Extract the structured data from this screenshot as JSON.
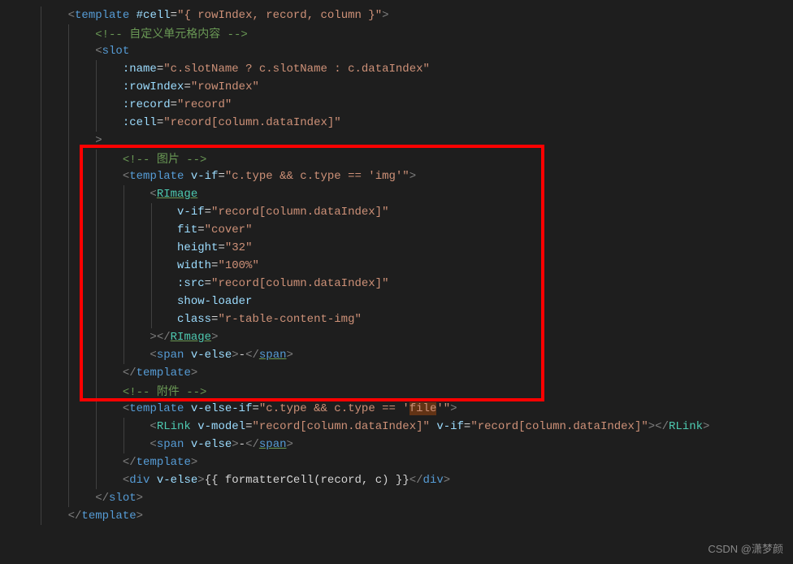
{
  "lines": [
    {
      "indent": 1,
      "segments": [
        {
          "t": "<",
          "c": "c-punct"
        },
        {
          "t": "template",
          "c": "c-tag"
        },
        {
          "t": " ",
          "c": ""
        },
        {
          "t": "#cell",
          "c": "c-attr"
        },
        {
          "t": "=",
          "c": "c-eq"
        },
        {
          "t": "\"{ rowIndex, record, column }\"",
          "c": "c-str"
        },
        {
          "t": ">",
          "c": "c-punct"
        }
      ]
    },
    {
      "indent": 2,
      "segments": [
        {
          "t": "<!-- 自定义单元格内容 -->",
          "c": "c-comment"
        }
      ]
    },
    {
      "indent": 2,
      "segments": [
        {
          "t": "<",
          "c": "c-punct"
        },
        {
          "t": "slot",
          "c": "c-tag"
        }
      ]
    },
    {
      "indent": 3,
      "segments": [
        {
          "t": ":name",
          "c": "c-attr"
        },
        {
          "t": "=",
          "c": "c-eq"
        },
        {
          "t": "\"c.slotName ? c.slotName : c.dataIndex\"",
          "c": "c-str"
        }
      ]
    },
    {
      "indent": 3,
      "segments": [
        {
          "t": ":rowIndex",
          "c": "c-attr"
        },
        {
          "t": "=",
          "c": "c-eq"
        },
        {
          "t": "\"rowIndex\"",
          "c": "c-str"
        }
      ]
    },
    {
      "indent": 3,
      "segments": [
        {
          "t": ":record",
          "c": "c-attr"
        },
        {
          "t": "=",
          "c": "c-eq"
        },
        {
          "t": "\"record\"",
          "c": "c-str"
        }
      ]
    },
    {
      "indent": 3,
      "segments": [
        {
          "t": ":cell",
          "c": "c-attr"
        },
        {
          "t": "=",
          "c": "c-eq"
        },
        {
          "t": "\"record[column.dataIndex]\"",
          "c": "c-str"
        }
      ]
    },
    {
      "indent": 2,
      "segments": [
        {
          "t": ">",
          "c": "c-punct"
        }
      ]
    },
    {
      "indent": 3,
      "segments": [
        {
          "t": "<!-- 图片 -->",
          "c": "c-comment"
        }
      ]
    },
    {
      "indent": 3,
      "segments": [
        {
          "t": "<",
          "c": "c-punct"
        },
        {
          "t": "template",
          "c": "c-tag"
        },
        {
          "t": " ",
          "c": ""
        },
        {
          "t": "v-if",
          "c": "c-attr"
        },
        {
          "t": "=",
          "c": "c-eq"
        },
        {
          "t": "\"c.type && c.type == 'img'\"",
          "c": "c-str"
        },
        {
          "t": ">",
          "c": "c-punct"
        }
      ]
    },
    {
      "indent": 4,
      "segments": [
        {
          "t": "<",
          "c": "c-punct"
        },
        {
          "t": "RImage",
          "c": "c-comp underline"
        }
      ]
    },
    {
      "indent": 5,
      "segments": [
        {
          "t": "v-if",
          "c": "c-attr"
        },
        {
          "t": "=",
          "c": "c-eq"
        },
        {
          "t": "\"record[column.dataIndex]\"",
          "c": "c-str"
        }
      ]
    },
    {
      "indent": 5,
      "segments": [
        {
          "t": "fit",
          "c": "c-attr"
        },
        {
          "t": "=",
          "c": "c-eq"
        },
        {
          "t": "\"cover\"",
          "c": "c-str"
        }
      ]
    },
    {
      "indent": 5,
      "segments": [
        {
          "t": "height",
          "c": "c-attr"
        },
        {
          "t": "=",
          "c": "c-eq"
        },
        {
          "t": "\"32\"",
          "c": "c-str"
        }
      ]
    },
    {
      "indent": 5,
      "segments": [
        {
          "t": "width",
          "c": "c-attr"
        },
        {
          "t": "=",
          "c": "c-eq"
        },
        {
          "t": "\"100%\"",
          "c": "c-str"
        }
      ]
    },
    {
      "indent": 5,
      "segments": [
        {
          "t": ":src",
          "c": "c-attr"
        },
        {
          "t": "=",
          "c": "c-eq"
        },
        {
          "t": "\"record[column.dataIndex]\"",
          "c": "c-str"
        }
      ]
    },
    {
      "indent": 5,
      "segments": [
        {
          "t": "show-loader",
          "c": "c-attr"
        }
      ]
    },
    {
      "indent": 5,
      "segments": [
        {
          "t": "class",
          "c": "c-attr"
        },
        {
          "t": "=",
          "c": "c-eq"
        },
        {
          "t": "\"r-table-content-img\"",
          "c": "c-str"
        }
      ]
    },
    {
      "indent": 4,
      "segments": [
        {
          "t": "></",
          "c": "c-punct"
        },
        {
          "t": "RImage",
          "c": "c-comp underline"
        },
        {
          "t": ">",
          "c": "c-punct"
        }
      ]
    },
    {
      "indent": 4,
      "segments": [
        {
          "t": "<",
          "c": "c-punct"
        },
        {
          "t": "span",
          "c": "c-tag"
        },
        {
          "t": " ",
          "c": ""
        },
        {
          "t": "v-else",
          "c": "c-attr"
        },
        {
          "t": ">",
          "c": "c-punct"
        },
        {
          "t": "-",
          "c": "c-text"
        },
        {
          "t": "</",
          "c": "c-punct"
        },
        {
          "t": "span",
          "c": "c-tag underline"
        },
        {
          "t": ">",
          "c": "c-punct"
        }
      ]
    },
    {
      "indent": 3,
      "segments": [
        {
          "t": "</",
          "c": "c-punct"
        },
        {
          "t": "template",
          "c": "c-tag"
        },
        {
          "t": ">",
          "c": "c-punct"
        }
      ]
    },
    {
      "indent": 3,
      "segments": [
        {
          "t": "<!-- 附件 -->",
          "c": "c-comment"
        }
      ]
    },
    {
      "indent": 3,
      "segments": [
        {
          "t": "<",
          "c": "c-punct"
        },
        {
          "t": "template",
          "c": "c-tag"
        },
        {
          "t": " ",
          "c": ""
        },
        {
          "t": "v-else-if",
          "c": "c-attr"
        },
        {
          "t": "=",
          "c": "c-eq"
        },
        {
          "t": "\"c.type && c.type == '",
          "c": "c-str"
        },
        {
          "t": "file",
          "c": "c-str c-hl"
        },
        {
          "t": "'\"",
          "c": "c-str"
        },
        {
          "t": ">",
          "c": "c-punct"
        }
      ]
    },
    {
      "indent": 4,
      "segments": [
        {
          "t": "<",
          "c": "c-punct"
        },
        {
          "t": "RLink",
          "c": "c-comp"
        },
        {
          "t": " ",
          "c": ""
        },
        {
          "t": "v-model",
          "c": "c-attr"
        },
        {
          "t": "=",
          "c": "c-eq"
        },
        {
          "t": "\"record[column.dataIndex]\"",
          "c": "c-str"
        },
        {
          "t": " ",
          "c": ""
        },
        {
          "t": "v-if",
          "c": "c-attr"
        },
        {
          "t": "=",
          "c": "c-eq"
        },
        {
          "t": "\"record[column.dataIndex]\"",
          "c": "c-str"
        },
        {
          "t": "></",
          "c": "c-punct"
        },
        {
          "t": "RLink",
          "c": "c-comp"
        },
        {
          "t": ">",
          "c": "c-punct"
        }
      ]
    },
    {
      "indent": 4,
      "segments": [
        {
          "t": "<",
          "c": "c-punct"
        },
        {
          "t": "span",
          "c": "c-tag"
        },
        {
          "t": " ",
          "c": ""
        },
        {
          "t": "v-else",
          "c": "c-attr"
        },
        {
          "t": ">",
          "c": "c-punct"
        },
        {
          "t": "-",
          "c": "c-text"
        },
        {
          "t": "</",
          "c": "c-punct"
        },
        {
          "t": "span",
          "c": "c-tag underline"
        },
        {
          "t": ">",
          "c": "c-punct"
        }
      ]
    },
    {
      "indent": 3,
      "segments": [
        {
          "t": "</",
          "c": "c-punct"
        },
        {
          "t": "template",
          "c": "c-tag"
        },
        {
          "t": ">",
          "c": "c-punct"
        }
      ]
    },
    {
      "indent": 3,
      "segments": [
        {
          "t": "<",
          "c": "c-punct"
        },
        {
          "t": "div",
          "c": "c-tag"
        },
        {
          "t": " ",
          "c": ""
        },
        {
          "t": "v-else",
          "c": "c-attr"
        },
        {
          "t": ">",
          "c": "c-punct"
        },
        {
          "t": "{{ formatterCell(record, c) }}",
          "c": "c-text"
        },
        {
          "t": "</",
          "c": "c-punct"
        },
        {
          "t": "div",
          "c": "c-tag"
        },
        {
          "t": ">",
          "c": "c-punct"
        }
      ]
    },
    {
      "indent": 2,
      "segments": [
        {
          "t": "</",
          "c": "c-punct"
        },
        {
          "t": "slot",
          "c": "c-tag"
        },
        {
          "t": ">",
          "c": "c-punct"
        }
      ]
    },
    {
      "indent": 1,
      "segments": [
        {
          "t": "</",
          "c": "c-punct"
        },
        {
          "t": "template",
          "c": "c-tag"
        },
        {
          "t": ">",
          "c": "c-punct"
        }
      ]
    }
  ],
  "highlight_word": "file",
  "watermark": "CSDN @潇梦颜",
  "indent_unit": "    "
}
